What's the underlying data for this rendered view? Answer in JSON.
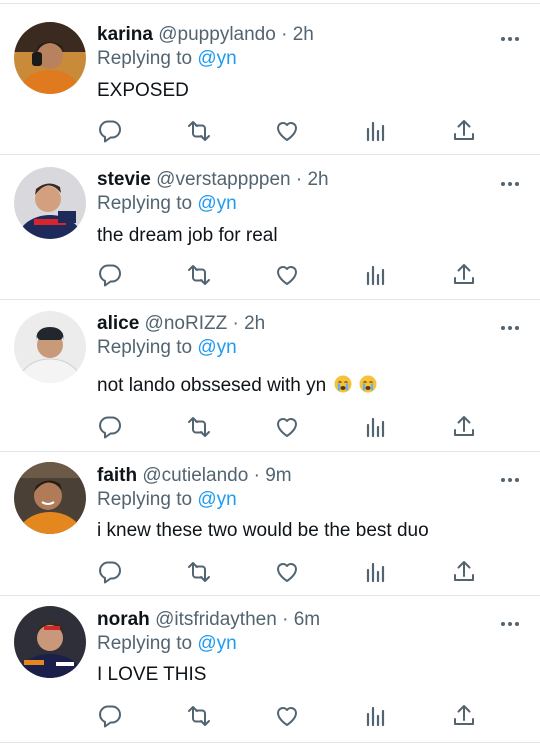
{
  "tweets": [
    {
      "display_name": "karina",
      "handle": "@puppylando",
      "dot": "·",
      "time": "2h",
      "replying_prefix": "Replying to",
      "replying_handle": "@yn",
      "text": "EXPOSED",
      "emojis": [],
      "avatar_colors": {
        "bg": "#c98a3a",
        "shirt": "#e07a1f",
        "skin": "#b8825e",
        "hair": "#2b1d14"
      }
    },
    {
      "display_name": "stevie",
      "handle": "@verstappppen",
      "dot": "·",
      "time": "2h",
      "replying_prefix": "Replying to",
      "replying_handle": "@yn",
      "text": "the dream job for real",
      "emojis": [],
      "avatar_colors": {
        "bg": "#d9d9dd",
        "shirt": "#1e2a5a",
        "skin": "#d2a07f",
        "hair": "#3b2a1f"
      }
    },
    {
      "display_name": "alice",
      "handle": "@noRIZZ",
      "dot": "·",
      "time": "2h",
      "replying_prefix": "Replying to",
      "replying_handle": "@yn",
      "text": "not lando obssesed with yn",
      "emojis": [
        "loudly-crying-face",
        "loudly-crying-face"
      ],
      "avatar_colors": {
        "bg": "#ececec",
        "shirt": "#f4f4f4",
        "skin": "#c89a7a",
        "hair": "#22262d"
      }
    },
    {
      "display_name": "faith",
      "handle": "@cutielando",
      "dot": "·",
      "time": "9m",
      "replying_prefix": "Replying to",
      "replying_handle": "@yn",
      "text": "i knew these two would be the best duo",
      "emojis": [],
      "avatar_colors": {
        "bg": "#4a4036",
        "shirt": "#e5871f",
        "skin": "#b07b58",
        "hair": "#2a1c12"
      }
    },
    {
      "display_name": "norah",
      "handle": "@itsfridaythen",
      "dot": "·",
      "time": "6m",
      "replying_prefix": "Replying to",
      "replying_handle": "@yn",
      "text": "I LOVE THIS",
      "emojis": [],
      "avatar_colors": {
        "bg": "#2f2f3a",
        "shirt": "#1b1f4a",
        "skin": "#c9977a",
        "hair": "#3a2a1e"
      }
    }
  ],
  "action_icons": [
    "reply-icon",
    "retweet-icon",
    "like-icon",
    "analytics-icon",
    "share-icon"
  ],
  "colors": {
    "name": "#0f1419",
    "meta": "#536471",
    "mention": "#1d9bf0",
    "divider": "#e1e6ea"
  }
}
